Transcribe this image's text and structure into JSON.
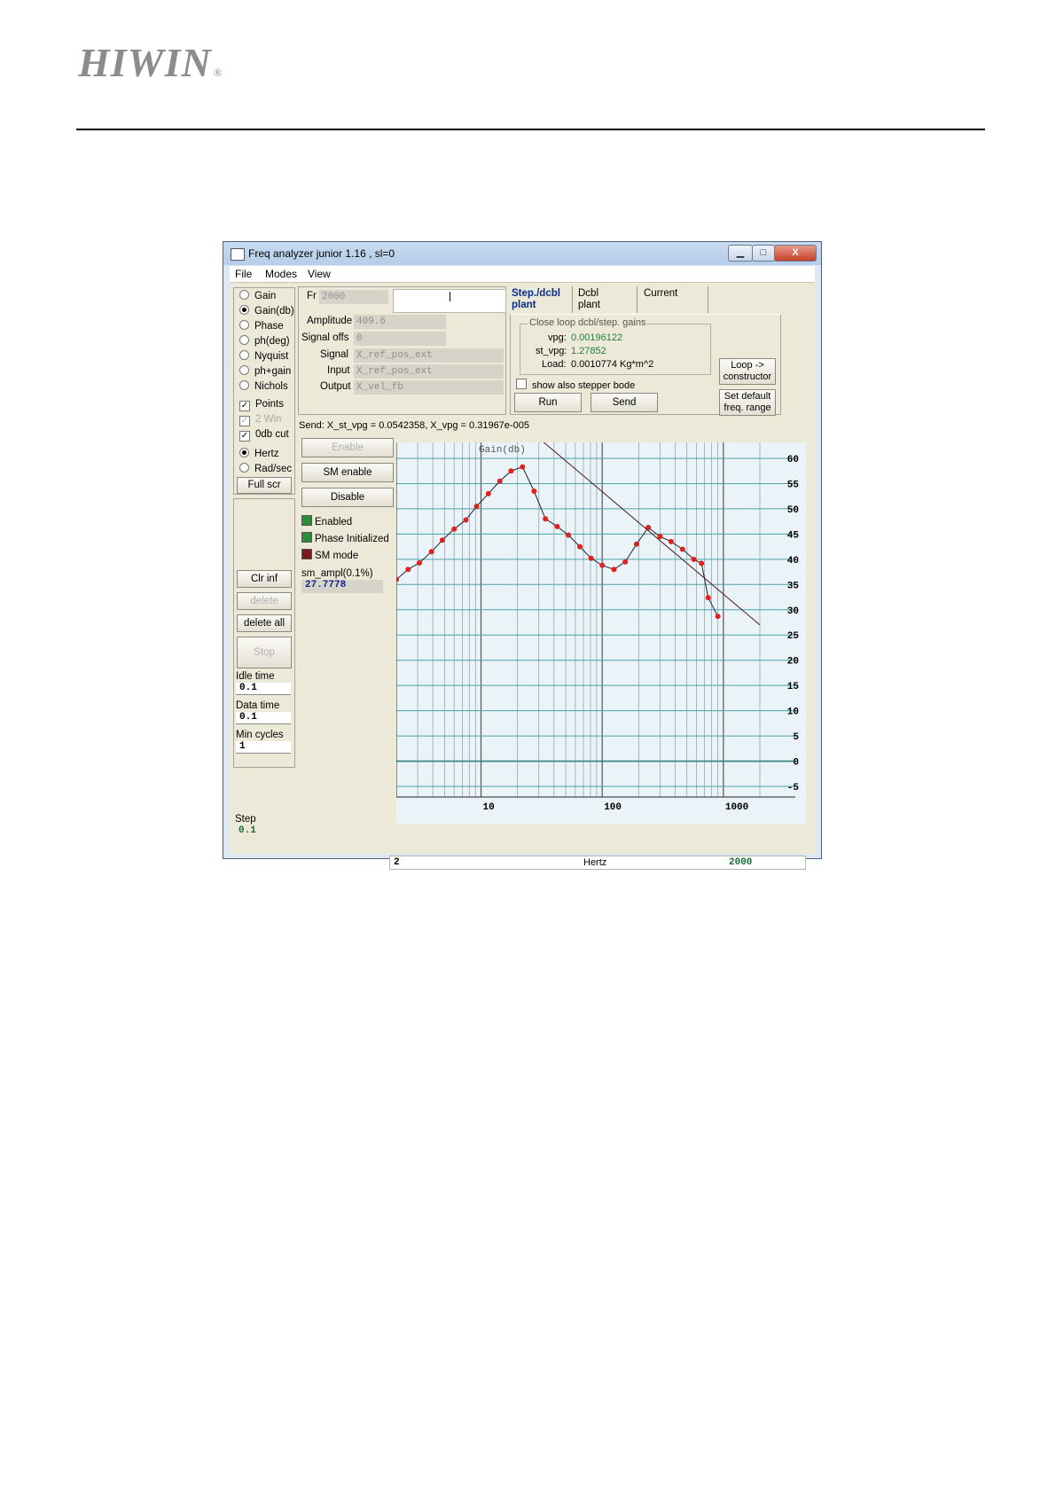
{
  "doc": {
    "brand": "HIWIN",
    "registered_mark": "®"
  },
  "window": {
    "title": "Freq analyzer junior 1.16 , sl=0",
    "controls": {
      "minimize": "▁",
      "maximize": "□",
      "close": "X"
    }
  },
  "menu": [
    "File",
    "Modes",
    "View"
  ],
  "left_panel": {
    "plot_modes": [
      {
        "label": "Gain",
        "selected": false
      },
      {
        "label": "Gain(db)",
        "selected": true
      },
      {
        "label": "Phase",
        "selected": false
      },
      {
        "label": "ph(deg)",
        "selected": false
      },
      {
        "label": "Nyquist",
        "selected": false
      },
      {
        "label": "ph+gain",
        "selected": false
      },
      {
        "label": "Nichols",
        "selected": false
      }
    ],
    "checks": [
      {
        "label": "Points",
        "checked": true,
        "enabled": true
      },
      {
        "label": "2 Win",
        "checked": true,
        "enabled": false
      },
      {
        "label": "0db cut",
        "checked": true,
        "enabled": true
      }
    ],
    "units": [
      {
        "label": "Hertz",
        "selected": true
      },
      {
        "label": "Rad/sec",
        "selected": false
      }
    ],
    "full_scr": "Full scr",
    "clr_inf": "Clr inf",
    "delete": "delete",
    "delete_all": "delete all",
    "stop": "Stop",
    "idle_time": {
      "label": "Idle time",
      "value": "0.1"
    },
    "data_time": {
      "label": "Data time",
      "value": "0.1"
    },
    "min_cycles": {
      "label": "Min cycles",
      "value": "1"
    },
    "step": {
      "label": "Step",
      "value": "0.1"
    }
  },
  "params": {
    "fr": {
      "label": "Fr",
      "value": "2000"
    },
    "amplitude": {
      "label": "Amplitude",
      "value": "409.6"
    },
    "signal_offs": {
      "label": "Signal offs",
      "value": "0"
    },
    "signal": {
      "label": "Signal",
      "value": "X_ref_pos_ext"
    },
    "input": {
      "label": "Input",
      "value": "X_ref_pos_ext"
    },
    "output": {
      "label": "Output",
      "value": "X_vel_fb"
    }
  },
  "tabs": [
    {
      "line1": "Step./dcbl",
      "line2": "plant",
      "active": true
    },
    {
      "line1": "Dcbl",
      "line2": "plant",
      "active": false
    },
    {
      "line1": "Current",
      "line2": "",
      "active": false
    }
  ],
  "gains": {
    "legend": "Close loop dcbl/step. gains",
    "vpg": {
      "label": "vpg:",
      "value": "0.00196122"
    },
    "st_vpg": {
      "label": "st_vpg:",
      "value": "1.27852"
    },
    "load": {
      "label": "Load:",
      "value": "0.0010774  Kg*m^2"
    }
  },
  "stepper_bode": {
    "label": "show also stepper bode",
    "checked": false
  },
  "run": "Run",
  "send": "Send",
  "loop_constructor": [
    "Loop ->",
    "constructor"
  ],
  "set_default": [
    "Set default",
    "freq. range"
  ],
  "send_status": "Send: X_st_vpg = 0.0542358, X_vpg = 0.31967e-005",
  "enable_buttons": {
    "enable": "Enable",
    "sm_enable": "SM enable",
    "disable": "Disable"
  },
  "indicators": [
    {
      "label": "Enabled",
      "color": "#2e8b3a"
    },
    {
      "label": "Phase Initialized",
      "color": "#2e8b3a"
    },
    {
      "label": "SM mode",
      "color": "#7a1a1a"
    }
  ],
  "sm_ampl": {
    "label": "sm_ampl(0.1%)",
    "value": "27.7778"
  },
  "freq_range": {
    "min": "2",
    "unit": "Hertz",
    "max": "2000"
  },
  "colors": {
    "grid": "#4aa3a8",
    "curve": "#1a2230",
    "points": "#e0201c",
    "background": "#e9f3f8"
  },
  "chart_data": {
    "type": "line",
    "title": "Gain(db)",
    "xlabel": "",
    "ylabel": "",
    "x_scale": "log",
    "xlim": [
      2,
      2000
    ],
    "ylim": [
      -5,
      60
    ],
    "x_ticks": [
      "10",
      "100",
      "1000"
    ],
    "y_ticks": [
      "60",
      "55",
      "50",
      "45",
      "40",
      "35",
      "30",
      "25",
      "20",
      "15",
      "10",
      "5",
      "0",
      "-5"
    ],
    "grid": true,
    "series": [
      {
        "x": [
          2,
          2.5,
          3.1,
          3.9,
          4.8,
          6,
          7.5,
          9.2,
          11.5,
          14.3,
          17.7,
          22,
          27.4,
          34,
          42.5,
          52.6,
          65.4,
          81,
          100,
          125,
          155,
          192,
          240,
          300,
          370,
          460,
          570,
          660,
          750,
          900
        ],
        "y": [
          36,
          38,
          39.3,
          41.5,
          43.8,
          46,
          47.8,
          50.5,
          53,
          55.5,
          57.5,
          58.3,
          53.5,
          48,
          46.5,
          44.8,
          42.5,
          40.2,
          38.8,
          38,
          39.5,
          43,
          46.3,
          44.5,
          43.5,
          42,
          40,
          39.2,
          32.4,
          28.7
        ]
      },
      {
        "x": [
          30,
          2000
        ],
        "y": [
          64,
          27
        ]
      }
    ]
  }
}
